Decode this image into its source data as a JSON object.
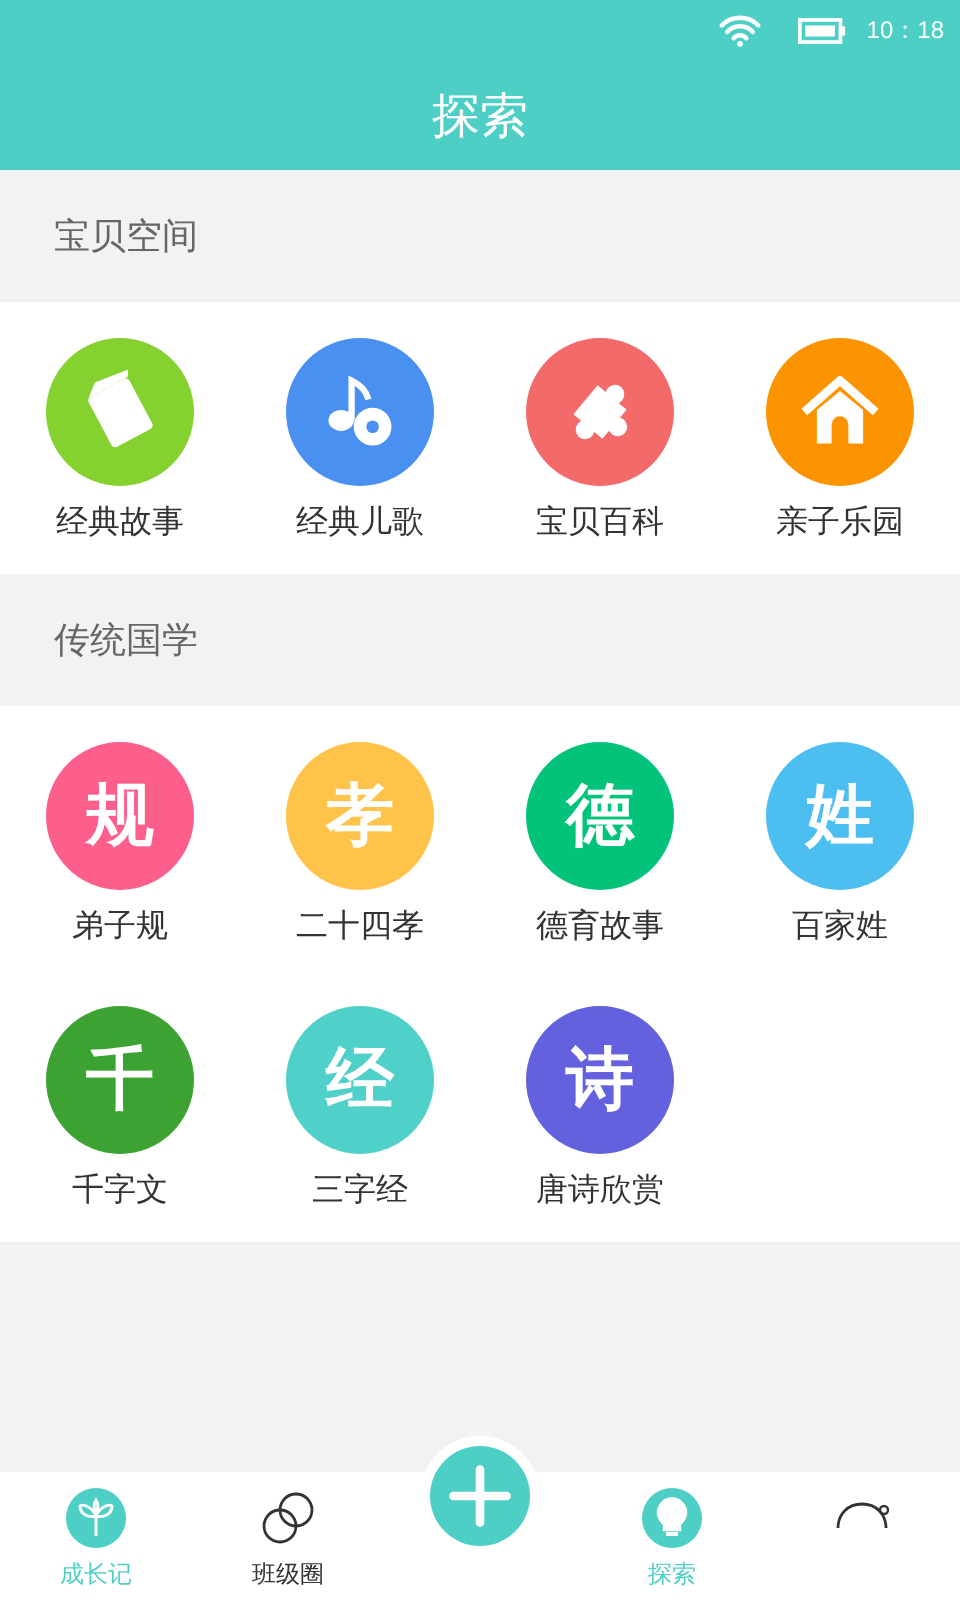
{
  "status_bar": {
    "time": "10：18"
  },
  "header": {
    "title": "探索"
  },
  "sections": [
    {
      "title": "宝贝空间",
      "items": [
        {
          "kind": "book",
          "label": "经典故事",
          "color": "#84d12f"
        },
        {
          "kind": "music",
          "label": "经典儿歌",
          "color": "#4a90f0"
        },
        {
          "kind": "puzzle",
          "label": "宝贝百科",
          "color": "#f26a6a"
        },
        {
          "kind": "house",
          "label": "亲子乐园",
          "color": "#fb9400"
        }
      ]
    },
    {
      "title": "传统国学",
      "items": [
        {
          "kind": "glyph",
          "glyph": "规",
          "label": "弟子规",
          "color": "#fc5f8c"
        },
        {
          "kind": "glyph",
          "glyph": "孝",
          "label": "二十四孝",
          "color": "#fec348"
        },
        {
          "kind": "glyph",
          "glyph": "德",
          "label": "德育故事",
          "color": "#03c37a"
        },
        {
          "kind": "glyph",
          "glyph": "姓",
          "label": "百家姓",
          "color": "#4cbff0"
        },
        {
          "kind": "glyph",
          "glyph": "千",
          "label": "千字文",
          "color": "#3ca232"
        },
        {
          "kind": "glyph",
          "glyph": "经",
          "label": "三字经",
          "color": "#4fd0c8"
        },
        {
          "kind": "glyph",
          "glyph": "诗",
          "label": "唐诗欣赏",
          "color": "#6461de"
        }
      ]
    }
  ],
  "bottom_nav": [
    {
      "kind": "sprout",
      "label": "成长记",
      "selected": true
    },
    {
      "kind": "rings",
      "label": "班级圈",
      "selected": false
    },
    {
      "kind": "add"
    },
    {
      "kind": "bulb",
      "label": "探索",
      "selected": true
    },
    {
      "kind": "face",
      "selected": false
    }
  ]
}
